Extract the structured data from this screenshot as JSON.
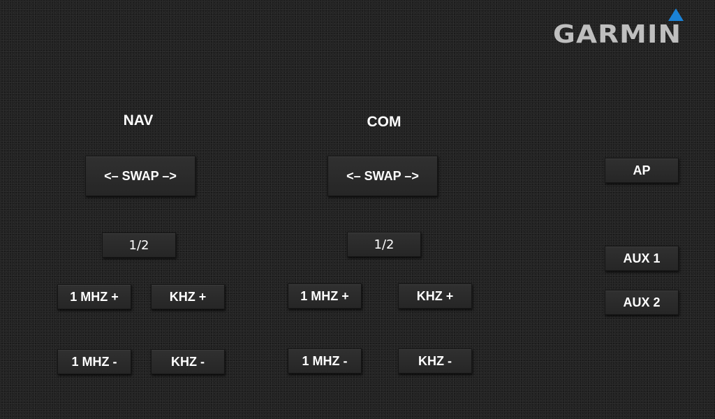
{
  "logo": {
    "text": "GARMIN",
    "icon": "blue-triangle-icon",
    "accent_color": "#1a82d6"
  },
  "nav": {
    "label": "NAV",
    "swap_label": "<– SWAP –>",
    "half_label": "1/2",
    "mhz_plus_label": "1 MHZ +",
    "khz_plus_label": "KHZ +",
    "mhz_minus_label": "1 MHZ -",
    "khz_minus_label": "KHZ -"
  },
  "com": {
    "label": "COM",
    "swap_label": "<– SWAP –>",
    "half_label": "1/2",
    "mhz_plus_label": "1 MHZ +",
    "khz_plus_label": "KHZ +",
    "mhz_minus_label": "1 MHZ -",
    "khz_minus_label": "KHZ -"
  },
  "side": {
    "ap_label": "AP",
    "aux1_label": "AUX 1",
    "aux2_label": "AUX 2"
  }
}
